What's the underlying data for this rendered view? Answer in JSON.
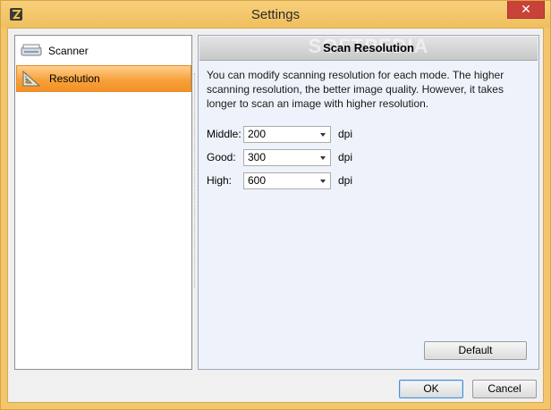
{
  "window": {
    "title": "Settings",
    "close_label": "✕",
    "icon": "app-icon"
  },
  "sidebar": {
    "items": [
      {
        "label": "Scanner",
        "icon": "scanner-icon",
        "selected": false
      },
      {
        "label": "Resolution",
        "icon": "resolution-icon",
        "selected": true
      }
    ]
  },
  "panel": {
    "title": "Scan Resolution",
    "watermark": "SOFTPEDIA",
    "description": "You can modify scanning resolution for each mode. The higher scanning resolution, the better image quality. However, it takes longer to scan an image with higher resolution.",
    "rows": [
      {
        "label": "Middle:",
        "value": "200",
        "unit": "dpi"
      },
      {
        "label": "Good:",
        "value": "300",
        "unit": "dpi"
      },
      {
        "label": "High:",
        "value": "600",
        "unit": "dpi"
      }
    ],
    "default_label": "Default"
  },
  "footer": {
    "ok_label": "OK",
    "cancel_label": "Cancel"
  },
  "colors": {
    "titlebar": "#f3c66b",
    "selection": "#f7a13c",
    "close": "#c9423a",
    "panel_bg": "#eef3fb"
  }
}
